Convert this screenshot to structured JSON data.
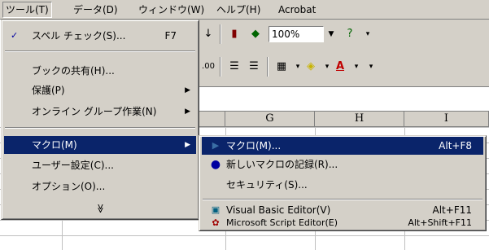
{
  "menubar": {
    "items": [
      {
        "label": "ツール(T)"
      },
      {
        "label": "データ(D)"
      },
      {
        "label": "ウィンドウ(W)"
      },
      {
        "label": "ヘルプ(H)"
      },
      {
        "label": "Acrobat"
      }
    ]
  },
  "toolbar": {
    "zoom_value": "100%"
  },
  "columns": [
    "G",
    "H",
    "I"
  ],
  "tools_menu": {
    "spelling": {
      "label": "スペル チェック(S)...",
      "shortcut": "F7",
      "icon": "spelling-check-icon"
    },
    "share_workbook": {
      "label": "ブックの共有(H)..."
    },
    "protection": {
      "label": "保護(P)"
    },
    "online_collab": {
      "label": "オンライン グループ作業(N)"
    },
    "macro": {
      "label": "マクロ(M)"
    },
    "customize": {
      "label": "ユーザー設定(C)..."
    },
    "options": {
      "label": "オプション(O)..."
    },
    "expand": {
      "label": "≫"
    }
  },
  "macro_menu": {
    "macros": {
      "label": "マクロ(M)...",
      "shortcut": "Alt+F8",
      "icon": "play-macro-icon"
    },
    "record": {
      "label": "新しいマクロの記録(R)...",
      "icon": "record-macro-icon"
    },
    "security": {
      "label": "セキュリティ(S)..."
    },
    "vbe": {
      "label": "Visual Basic Editor(V)",
      "shortcut": "Alt+F11",
      "icon": "visual-basic-editor-icon"
    },
    "script_editor": {
      "label": "Microsoft Script Editor(E)",
      "shortcut": "Alt+Shift+F11",
      "icon": "script-editor-icon"
    }
  },
  "colors": {
    "menu_face": "#d4d0c8",
    "highlight": "#0a246a",
    "highlight_text": "#ffffff"
  }
}
